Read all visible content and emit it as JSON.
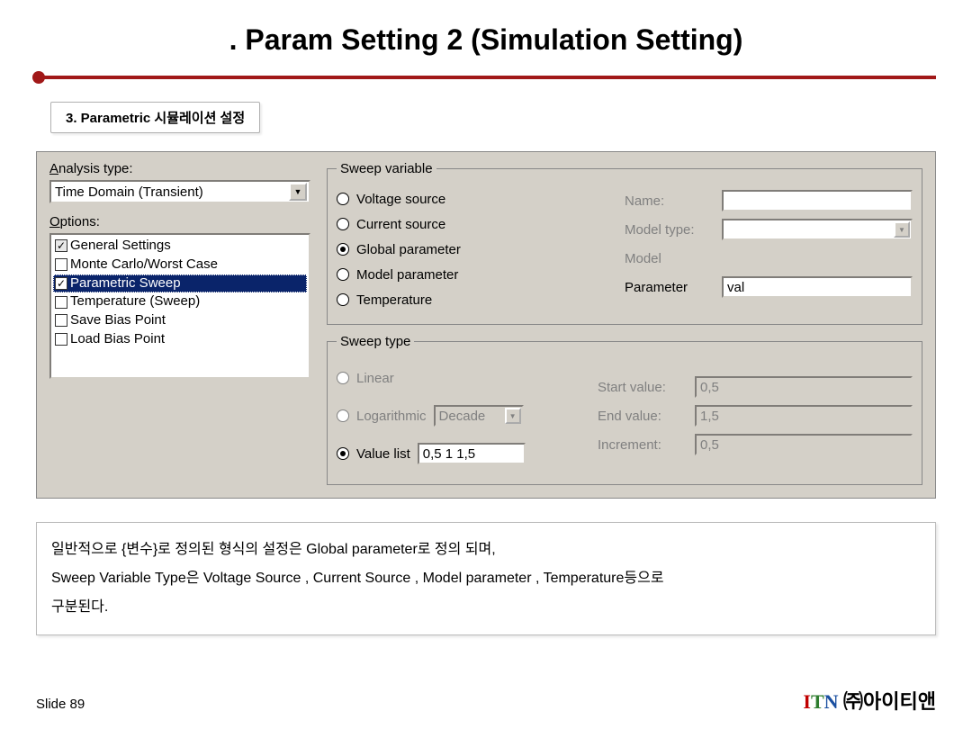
{
  "title": ". Param Setting 2 (Simulation Setting)",
  "section_label": "3.  Parametric 시뮬레이션 설정",
  "left": {
    "analysis_label": "Analysis type:",
    "analysis_value": "Time Domain (Transient)",
    "options_label": "Options:",
    "items": [
      {
        "label": "General Settings",
        "checked": true,
        "gray": true,
        "selected": false
      },
      {
        "label": "Monte Carlo/Worst Case",
        "checked": false,
        "gray": false,
        "selected": false
      },
      {
        "label": "Parametric Sweep",
        "checked": true,
        "gray": false,
        "selected": true
      },
      {
        "label": "Temperature (Sweep)",
        "checked": false,
        "gray": false,
        "selected": false
      },
      {
        "label": "Save Bias Point",
        "checked": false,
        "gray": false,
        "selected": false
      },
      {
        "label": "Load Bias Point",
        "checked": false,
        "gray": false,
        "selected": false
      }
    ]
  },
  "sweep_variable": {
    "legend": "Sweep variable",
    "radios": [
      {
        "label": "Voltage source",
        "u": "V",
        "selected": false
      },
      {
        "label": "Current source",
        "u": "C",
        "selected": false
      },
      {
        "label": "Global parameter",
        "u": "G",
        "selected": true
      },
      {
        "label": "Model parameter",
        "u": "M",
        "selected": false
      },
      {
        "label": "Temperature",
        "u": "T",
        "selected": false
      }
    ],
    "fields": {
      "name": {
        "label": "Name:",
        "u": "N",
        "value": "",
        "disabled": true
      },
      "model_type": {
        "label": "Model type:",
        "value": "",
        "disabled": true,
        "combo": true
      },
      "model": {
        "label": "Model",
        "value": "",
        "disabled": true,
        "noborder": true
      },
      "parameter": {
        "label": "Parameter",
        "u": "P",
        "value": "val",
        "disabled": false
      }
    }
  },
  "sweep_type": {
    "legend": "Sweep type",
    "radios": [
      {
        "label": "Linear",
        "u": "L",
        "selected": false
      },
      {
        "label": "Logarithmic",
        "u": "h",
        "selected": false,
        "combo": "Decade"
      },
      {
        "label": "Value list",
        "u": "s",
        "selected": true,
        "value": "0,5 1 1,5"
      }
    ],
    "fields": {
      "start": {
        "label": "Start value:",
        "u": "r",
        "value": "0,5",
        "disabled": true
      },
      "end": {
        "label": "End value:",
        "u": "a",
        "value": "1,5",
        "disabled": true
      },
      "increment": {
        "label": "Increment:",
        "u": "I",
        "value": "0,5",
        "disabled": true
      }
    }
  },
  "description": {
    "line1": "일반적으로 {변수}로 정의된 형식의 설정은 Global parameter로 정의 되며,",
    "line2": "Sweep Variable Type은 Voltage Source , Current Source , Model parameter , Temperature등으로",
    "line3": "구분된다."
  },
  "footer": {
    "slide": "Slide 89",
    "brand_kr": "㈜아이티앤"
  }
}
